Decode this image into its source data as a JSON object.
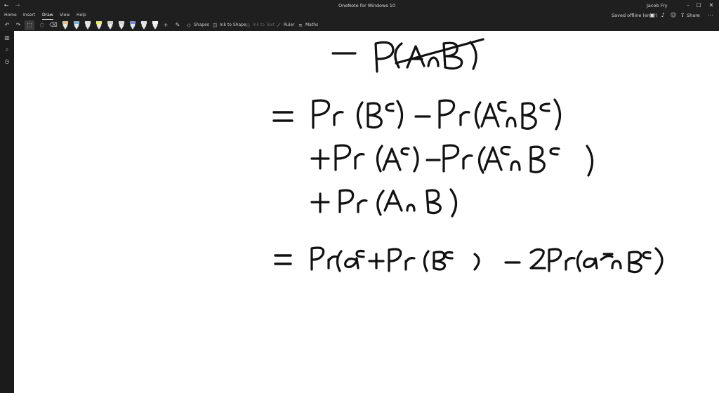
{
  "window": {
    "title": "OneNote for Windows 10",
    "user": "Jacob Fry",
    "status": "Saved offline (error)",
    "share_label": "Share"
  },
  "menu": {
    "items": [
      "Home",
      "Insert",
      "Draw",
      "View",
      "Help"
    ],
    "active": "Draw"
  },
  "toolbar": {
    "shapes_label": "Shapes",
    "ink_to_shape_label": "Ink to Shape",
    "ink_to_text_label": "Ink to Text",
    "ruler_label": "Ruler",
    "maths_label": "Maths",
    "pen_colors": [
      "#e0c36a",
      "#6ab7e0",
      "#e0e0e0",
      "#f4ea3c",
      "#cfcfcf",
      "#d6d6d6",
      "#6a8fe0",
      "#e0e0e0",
      "#f0f0f0"
    ]
  },
  "icons": {
    "back": "←",
    "forward": "→",
    "undo": "↶",
    "redo": "↷",
    "lasso": "◌",
    "eraser": "⌫",
    "add": "+",
    "pen_settings": "✎",
    "minimize": "–",
    "maximize": "☐",
    "close": "✕",
    "notebooks": "▥",
    "search": "⌕",
    "recent": "◷"
  }
}
